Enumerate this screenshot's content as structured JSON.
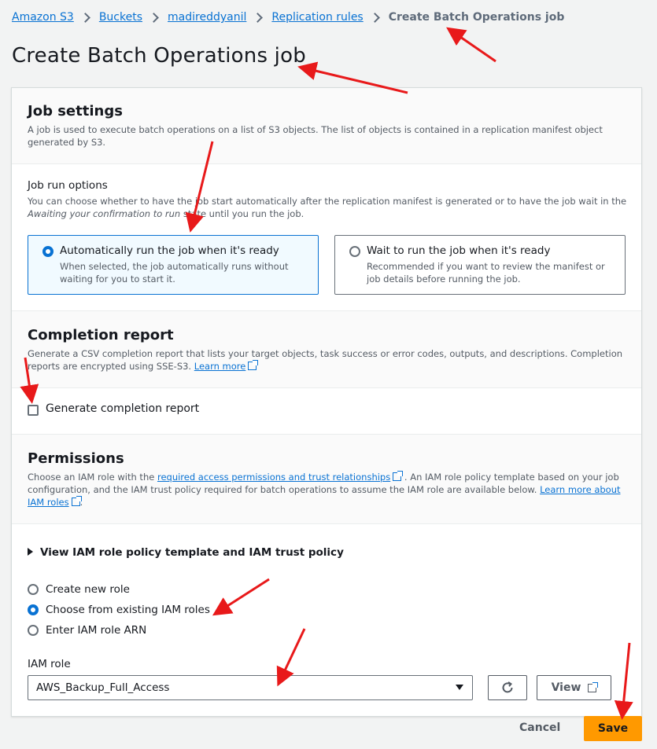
{
  "breadcrumbs": [
    "Amazon S3",
    "Buckets",
    "madireddyanil",
    "Replication rules"
  ],
  "breadcrumb_current": "Create Batch Operations job",
  "page_title": "Create Batch Operations job",
  "job_settings": {
    "title": "Job settings",
    "description": "A job is used to execute batch operations on a list of S3 objects. The list of objects is contained in a replication manifest object generated by S3.",
    "run_options_label": "Job run options",
    "run_options_desc_1": "You can choose whether to have the job start automatically after the replication manifest is generated or to have the job wait in the",
    "run_options_desc_italic": "Awaiting your confirmation to run",
    "run_options_desc_2": " state until you run the job.",
    "auto_title": "Automatically run the job when it's ready",
    "auto_desc": "When selected, the job automatically runs without waiting for you to start it.",
    "wait_title": "Wait to run the job when it's ready",
    "wait_desc": "Recommended if you want to review the manifest or job details before running the job."
  },
  "completion_report": {
    "title": "Completion report",
    "description": "Generate a CSV completion report that lists your target objects, task success or error codes, outputs, and descriptions. Completion reports are encrypted using SSE-S3. ",
    "learn_more": "Learn more",
    "checkbox_label": "Generate completion report"
  },
  "permissions": {
    "title": "Permissions",
    "desc_1": "Choose an IAM role with the ",
    "link_1": "required access permissions and trust relationships",
    "desc_2": " . An IAM role policy template based on your job configuration, and the IAM trust policy required for batch operations to assume the IAM role are available below. ",
    "link_2": "Learn more about IAM roles",
    "desc_3": ".",
    "expander": "View IAM role policy template and IAM trust policy",
    "options": [
      "Create new role",
      "Choose from existing IAM roles",
      "Enter IAM role ARN"
    ],
    "iam_role_label": "IAM role",
    "iam_role_value": "AWS_Backup_Full_Access",
    "view_button": "View"
  },
  "footer": {
    "cancel": "Cancel",
    "save": "Save"
  },
  "colors": {
    "accent": "#0972d3",
    "save": "#ff9900",
    "annotation": "#e8191a"
  }
}
